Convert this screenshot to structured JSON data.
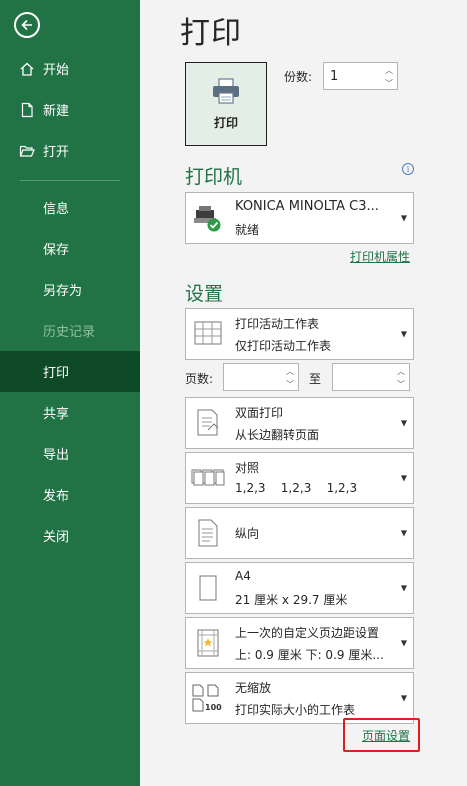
{
  "sidebar": {
    "bg_color": "#217346",
    "active_color": "#0e4a27",
    "back_icon": "arrow-left-circle-icon",
    "items": [
      {
        "label": "开始",
        "icon": "home-icon"
      },
      {
        "label": "新建",
        "icon": "new-document-icon"
      },
      {
        "label": "打开",
        "icon": "open-folder-icon"
      },
      {
        "label": "信息"
      },
      {
        "label": "保存"
      },
      {
        "label": "另存为"
      },
      {
        "label": "历史记录",
        "disabled": true
      },
      {
        "label": "打印",
        "active": true
      },
      {
        "label": "共享"
      },
      {
        "label": "导出"
      },
      {
        "label": "发布"
      },
      {
        "label": "关闭"
      }
    ]
  },
  "main": {
    "title": "打印",
    "print_button_label": "打印",
    "copies_label": "份数:",
    "copies_value": "1",
    "printer_section": "打印机",
    "printer_name": "KONICA MINOLTA C3...",
    "printer_status": "就绪",
    "printer_properties_link": "打印机属性",
    "settings_section": "设置",
    "print_what_line1": "打印活动工作表",
    "print_what_line2": "仅打印活动工作表",
    "pages_label": "页数:",
    "pages_to_label": "至",
    "pages_from": "",
    "pages_to": "",
    "duplex_line1": "双面打印",
    "duplex_line2": "从长边翻转页面",
    "collate_line1": "对照",
    "collate_line2": "1,2,3    1,2,3    1,2,3",
    "orientation": "纵向",
    "paper_line1": "A4",
    "paper_line2": "21 厘米 x 29.7 厘米",
    "margins_line1": "上一次的自定义页边距设置",
    "margins_line2": "上: 0.9 厘米 下: 0.9 厘米...",
    "scaling_line1": "无缩放",
    "scaling_line2": "打印实际大小的工作表",
    "page_setup_link": "页面设置",
    "accent_color": "#217346",
    "highlight_color": "#e02020"
  }
}
